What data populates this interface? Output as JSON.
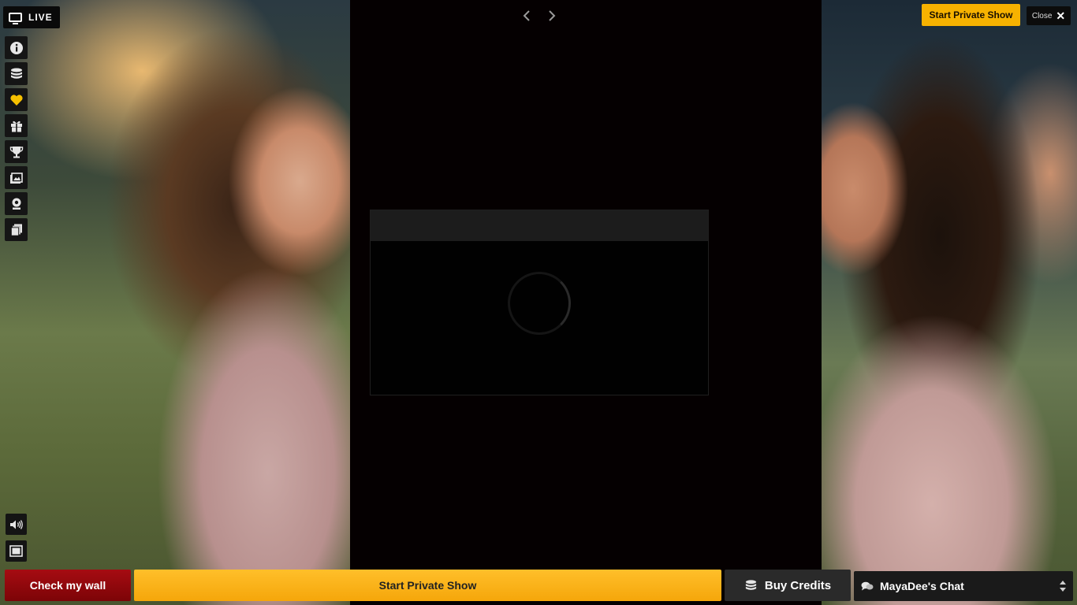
{
  "header": {
    "live_label": "LIVE",
    "close_label": "Close",
    "start_private_label": "Start Private Show"
  },
  "toolbar": {
    "items": [
      {
        "icon": "info-icon"
      },
      {
        "icon": "coins-icon"
      },
      {
        "icon": "heart-icon"
      },
      {
        "icon": "gift-icon"
      },
      {
        "icon": "trophy-icon"
      },
      {
        "icon": "gallery-icon"
      },
      {
        "icon": "webcam-icon"
      },
      {
        "icon": "stack-icon"
      }
    ]
  },
  "footer": {
    "wall_label": "Check my wall",
    "private_label": "Start Private Show",
    "credits_label": "Buy Credits",
    "chat_label": "MayaDee's Chat"
  },
  "colors": {
    "accent": "#f7b200",
    "wall": "#a60c12",
    "heart": "#f5c000"
  }
}
